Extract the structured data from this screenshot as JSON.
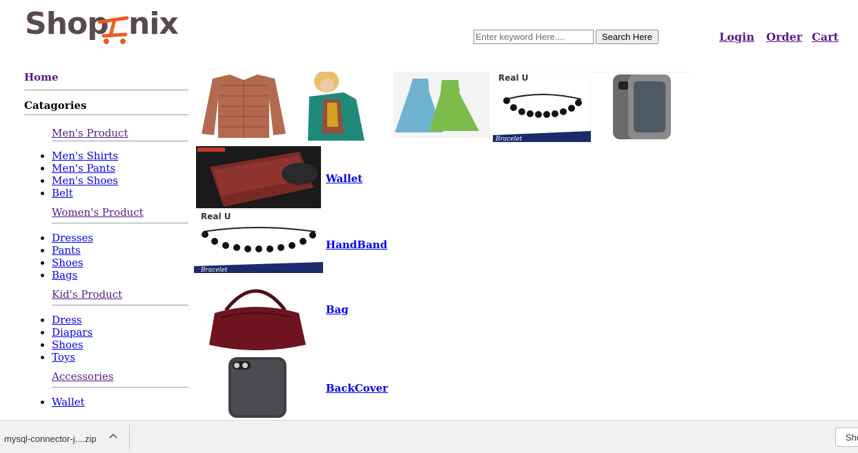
{
  "header": {
    "logo_text": "Shopnix",
    "search": {
      "placeholder": "Enter keyword Here....",
      "button_label": "Search Here"
    },
    "nav": {
      "login": "Login",
      "order": "Order",
      "cart": "Cart"
    }
  },
  "sidebar": {
    "home": "Home",
    "categories_heading": "Catagories",
    "groups": [
      {
        "title": "Men's Product",
        "items": [
          "Men's Shirts",
          "Men's Pants",
          "Men's Shoes",
          "Belt"
        ]
      },
      {
        "title": "Women's Product",
        "items": [
          "Dresses",
          "Pants",
          "Shoes",
          "Bags"
        ]
      },
      {
        "title": "Kid's Product",
        "items": [
          "Dress",
          "Diapars",
          "Shoes",
          "Toys"
        ]
      },
      {
        "title": "Accessories",
        "items": [
          "Wallet"
        ]
      }
    ]
  },
  "banner": {
    "bracelet_brand": "Real U",
    "bracelet_caption": "Bracelet"
  },
  "products": [
    {
      "name": "Wallet"
    },
    {
      "name": "HandBand",
      "brand": "Real U",
      "caption": "Bracelet"
    },
    {
      "name": "Bag"
    },
    {
      "name": "BackCover"
    }
  ],
  "download_bar": {
    "filename": "mysql-connector-j....zip",
    "show_all_label": "Show all"
  },
  "colors": {
    "link": "#0000ee",
    "visited": "#551a8b",
    "logo_dark": "#5a4a4f",
    "logo_orange": "#f05a22"
  }
}
